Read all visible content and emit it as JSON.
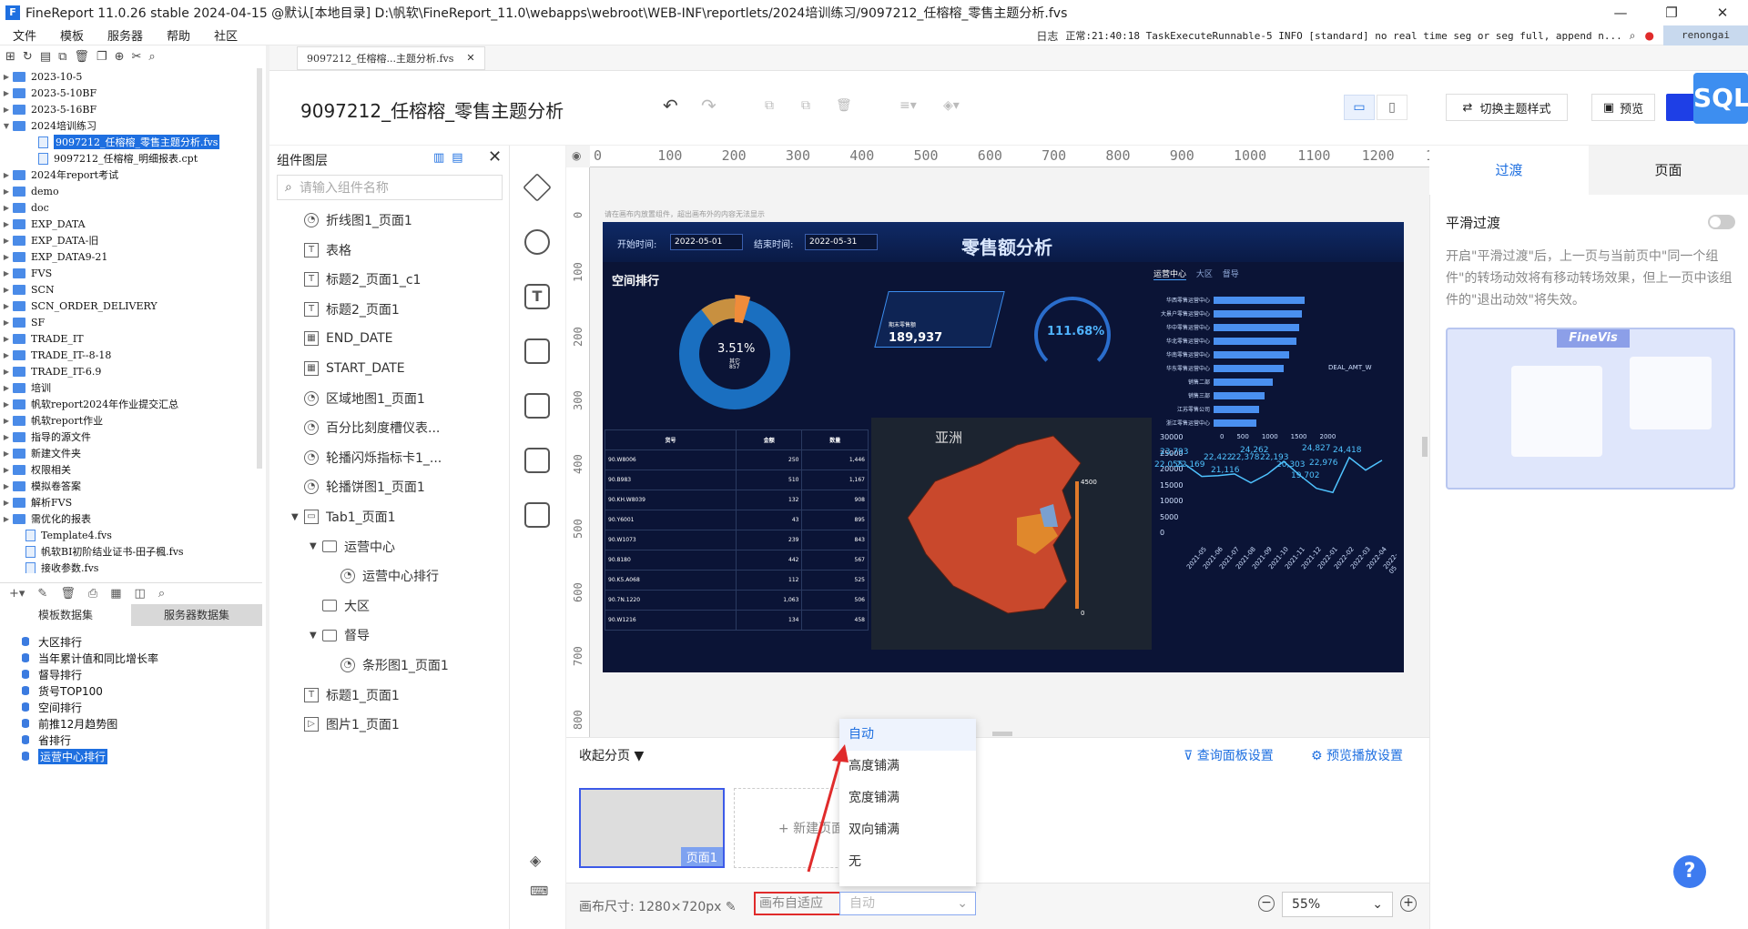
{
  "window": {
    "title": "FineReport 11.0.26 stable 2024-04-15 @默认[本地目录]    D:\\帆软\\FineReport_11.0\\webapps\\webroot\\WEB-INF\\reportlets/2024培训练习/9097212_任榕榕_零售主题分析.fvs",
    "logo": "F"
  },
  "menu": [
    "文件",
    "模板",
    "服务器",
    "帮助",
    "社区"
  ],
  "log": {
    "label": "日志",
    "text": "正常:21:40:18 TaskExecuteRunnable-5 INFO [standard] no real time seg or seg full, append n...",
    "user": "renongai"
  },
  "tree": [
    {
      "label": "2023-10-5",
      "type": "folder"
    },
    {
      "label": "2023-5-10BF",
      "type": "folder"
    },
    {
      "label": "2023-5-16BF",
      "type": "folder"
    },
    {
      "label": "2024培训练习",
      "type": "folder",
      "open": true
    },
    {
      "label": "9097212_任榕榕_零售主题分析.fvs",
      "type": "file",
      "indent": 2,
      "selected": true
    },
    {
      "label": "9097212_任榕榕_明细报表.cpt",
      "type": "file",
      "indent": 2
    },
    {
      "label": "2024年report考试",
      "type": "folder"
    },
    {
      "label": "demo",
      "type": "folder"
    },
    {
      "label": "doc",
      "type": "folder"
    },
    {
      "label": "EXP_DATA",
      "type": "folder"
    },
    {
      "label": "EXP_DATA-旧",
      "type": "folder"
    },
    {
      "label": "EXP_DATA9-21",
      "type": "folder"
    },
    {
      "label": "FVS",
      "type": "folder"
    },
    {
      "label": "SCN",
      "type": "folder"
    },
    {
      "label": "SCN_ORDER_DELIVERY",
      "type": "folder"
    },
    {
      "label": "SF",
      "type": "folder"
    },
    {
      "label": "TRADE_IT",
      "type": "folder"
    },
    {
      "label": "TRADE_IT--8-18",
      "type": "folder"
    },
    {
      "label": "TRADE_IT-6.9",
      "type": "folder"
    },
    {
      "label": "培训",
      "type": "folder"
    },
    {
      "label": "帆软report2024年作业提交汇总",
      "type": "folder"
    },
    {
      "label": "帆软report作业",
      "type": "folder"
    },
    {
      "label": "指导的源文件",
      "type": "folder"
    },
    {
      "label": "新建文件夹",
      "type": "folder"
    },
    {
      "label": "权限相关",
      "type": "folder"
    },
    {
      "label": "模拟卷答案",
      "type": "folder"
    },
    {
      "label": "解析FVS",
      "type": "folder"
    },
    {
      "label": "需优化的报表",
      "type": "folder"
    },
    {
      "label": "Template4.fvs",
      "type": "file",
      "indent": 1
    },
    {
      "label": "帆软BI初阶结业证书-田子楓.fvs",
      "type": "file",
      "indent": 1
    },
    {
      "label": "接收参数.fvs",
      "type": "file",
      "indent": 1
    }
  ],
  "dataset_tabs": [
    "模板数据集",
    "服务器数据集"
  ],
  "datasets": [
    {
      "label": "大区排行"
    },
    {
      "label": "当年累计值和同比增长率"
    },
    {
      "label": "督导排行"
    },
    {
      "label": "货号TOP100"
    },
    {
      "label": "空间排行"
    },
    {
      "label": "前推12月趋势图"
    },
    {
      "label": "省排行"
    },
    {
      "label": "运营中心排行",
      "selected": true
    }
  ],
  "editor_tab": "9097212_任榕榕...主题分析.fvs",
  "doc_title": "9097212_任榕榕_零售主题分析",
  "toolbar": {
    "theme_label": "切换主题样式",
    "preview_label": "预览",
    "sql_badge": "SQL"
  },
  "layers": {
    "header": "组件图层",
    "search_placeholder": "请输入组件名称",
    "items": [
      {
        "label": "折线图1_页面1",
        "icon": "chart"
      },
      {
        "label": "表格",
        "icon": "text"
      },
      {
        "label": "标题2_页面1_c1",
        "icon": "text"
      },
      {
        "label": "标题2_页面1",
        "icon": "text"
      },
      {
        "label": "END_DATE",
        "icon": "table"
      },
      {
        "label": "START_DATE",
        "icon": "table"
      },
      {
        "label": "区域地图1_页面1",
        "icon": "chart"
      },
      {
        "label": "百分比刻度槽仪表...",
        "icon": "chart"
      },
      {
        "label": "轮播闪烁指标卡1_...",
        "icon": "chart"
      },
      {
        "label": "轮播饼图1_页面1",
        "icon": "chart"
      },
      {
        "label": "Tab1_页面1",
        "icon": "tab",
        "caret": "▼"
      },
      {
        "label": "运营中心",
        "icon": "folder",
        "caret": "▼",
        "indent": 1
      },
      {
        "label": "运营中心排行",
        "icon": "chart",
        "indent": 2
      },
      {
        "label": "大区",
        "icon": "folder",
        "indent": 1
      },
      {
        "label": "督导",
        "icon": "folder",
        "caret": "▼",
        "indent": 1
      },
      {
        "label": "条形图1_页面1",
        "icon": "chart",
        "indent": 2
      },
      {
        "label": "标题1_页面1",
        "icon": "text"
      },
      {
        "label": "图片1_页面1",
        "icon": "image"
      }
    ]
  },
  "hruler": [
    "0",
    "100",
    "200",
    "300",
    "400",
    "500",
    "600",
    "700",
    "800",
    "900",
    "1000",
    "1100",
    "1200",
    "1"
  ],
  "vruler": [
    "0",
    "100",
    "200",
    "300",
    "400",
    "500",
    "600",
    "700",
    "800"
  ],
  "canvas_hint": "请在画布内放置组件，超出画布外的内容无法显示",
  "dashboard": {
    "title": "零售额分析",
    "start_label": "开始时间:",
    "start_value": "2022-05-01",
    "end_label": "结束时间:",
    "end_value": "2022-05-31",
    "section": "空间排行",
    "donut": {
      "percent": "3.51%",
      "label": "其它",
      "value": "857"
    },
    "kpi": {
      "label": "期末零售额",
      "value": "189,937"
    },
    "gauge": "111.68%",
    "tabs": [
      "运营中心",
      "大区",
      "督导"
    ],
    "map_region": "亚洲",
    "map_max": "4500",
    "map_min": "0",
    "bars": {
      "legend": "DEAL_AMT_W",
      "axis": [
        "0",
        "500",
        "1000",
        "1500",
        "2000"
      ],
      "items": [
        {
          "label": "华西零售运营中心",
          "value": 1700
        },
        {
          "label": "大景户零售运营中心",
          "value": 1650
        },
        {
          "label": "华中零售运营中心",
          "value": 1600
        },
        {
          "label": "华北零售运营中心",
          "value": 1550
        },
        {
          "label": "华南零售运营中心",
          "value": 1400
        },
        {
          "label": "华东零售运营中心",
          "value": 1300
        },
        {
          "label": "销售二部",
          "value": 1100
        },
        {
          "label": "销售三部",
          "value": 950
        },
        {
          "label": "江苏零售公司",
          "value": 850
        },
        {
          "label": "浙江零售运营中心",
          "value": 800
        }
      ]
    },
    "table": {
      "headers": [
        "货号",
        "金额",
        "数量"
      ],
      "rows": [
        [
          "90.W8006",
          "250",
          "1,446"
        ],
        [
          "90.B983",
          "510",
          "1,167"
        ],
        [
          "90.KH.W8039",
          "132",
          "908"
        ],
        [
          "90.Y6001",
          "43",
          "895"
        ],
        [
          "90.W1073",
          "239",
          "843"
        ],
        [
          "90.8180",
          "442",
          "567"
        ],
        [
          "90.K5.A068",
          "112",
          "525"
        ],
        [
          "90.7N.1220",
          "1,063",
          "506"
        ],
        [
          "90.W1216",
          "134",
          "458"
        ]
      ]
    },
    "line": {
      "yaxis": [
        "30000",
        "25000",
        "20000",
        "15000",
        "10000",
        "5000",
        "0"
      ],
      "labels": [
        "23,793",
        "22,055",
        "22,169",
        "22,422",
        "21,116",
        "22,378",
        "24,262",
        "22,193",
        "20,303",
        "19,702",
        "24,827",
        "22,976",
        "24,418"
      ],
      "xaxis": [
        "2021-05",
        "2021-06",
        "2021-07",
        "2021-08",
        "2021-09",
        "2021-10",
        "2021-11",
        "2021-12",
        "2022-01",
        "2022-02",
        "2022-03",
        "2022-04",
        "2022-05"
      ]
    }
  },
  "pagebar": {
    "collapse_label": "收起分页",
    "query_panel": "查询面板设置",
    "play_settings": "预览播放设置",
    "page_label": "页面1",
    "new_page": "+ 新建页面"
  },
  "bottom": {
    "canvas_size": "画布尺寸:  1280×720px",
    "autofit_label": "画布自适应",
    "select_value": "自动",
    "zoom": "55%"
  },
  "dropdown": [
    "自动",
    "高度铺满",
    "宽度铺满",
    "双向铺满",
    "无"
  ],
  "rightpanel": {
    "tabs": [
      "过渡",
      "页面"
    ],
    "smooth_label": "平滑过渡",
    "smooth_desc": "开启\"平滑过渡\"后，上一页与当前页中\"同一个组件\"的转场动效将有移动转场效果，但上一页中该组件的\"退出动效\"将失效。",
    "finevis": "FineVis"
  },
  "colors": {
    "accent": "#1e6fe0",
    "highlight_red": "#e02b2b",
    "dashboard_bg": "#0b1436"
  }
}
